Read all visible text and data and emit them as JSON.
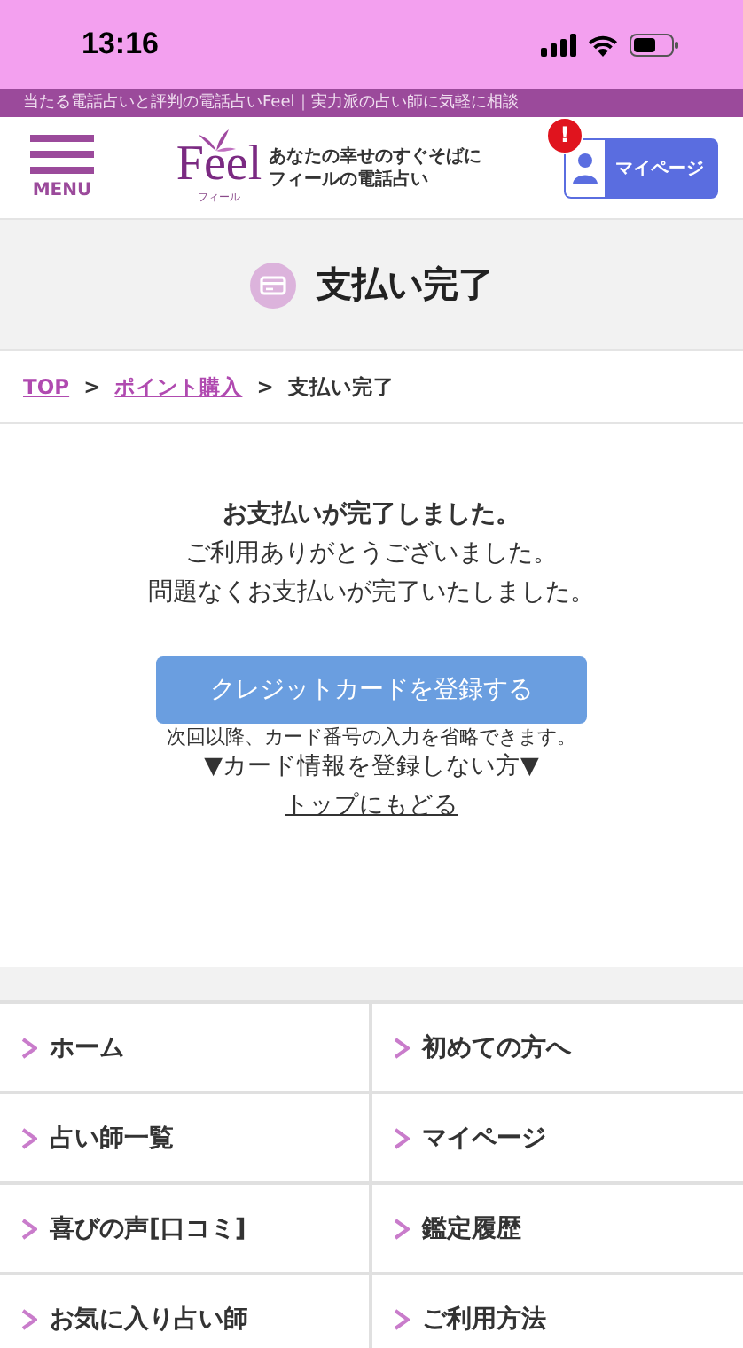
{
  "status_bar": {
    "time": "13:16"
  },
  "tagline": "当たる電話占いと評判の電話占いFeel｜実力派の占い師に気軽に相談",
  "header": {
    "menu_label": "MENU",
    "logo_text": "Feel",
    "logo_sub": "フィール",
    "catch_lines": [
      "あなたの幸せのすぐそばに",
      "フィールの電話占い"
    ],
    "mypage_label": "マイページ",
    "alert_badge": "!"
  },
  "page_title": "支払い完了",
  "breadcrumb": [
    {
      "label": "TOP",
      "kind": "link"
    },
    {
      "label": ">",
      "kind": "sep"
    },
    {
      "label": "ポイント購入",
      "kind": "link"
    },
    {
      "label": ">",
      "kind": "sep"
    },
    {
      "label": "支払い完了",
      "kind": "current"
    }
  ],
  "message": {
    "heading": "お支払いが完了しました。",
    "lines": [
      "ご利用ありがとうございました。",
      "問題なくお支払いが完了いたしました。"
    ]
  },
  "register_button": "クレジットカードを登録する",
  "register_note": "次回以降、カード番号の入力を省略できます。",
  "skip_note": "▼カード情報を登録しない方▼",
  "back_link": "トップにもどる",
  "nav_menu": [
    {
      "label": "ホーム"
    },
    {
      "label": "初めての方へ"
    },
    {
      "label": "占い師一覧"
    },
    {
      "label": "マイページ"
    },
    {
      "label": "喜びの声[口コミ]"
    },
    {
      "label": "鑑定履歴"
    },
    {
      "label": "お気に入り占い師"
    },
    {
      "label": "ご利用方法"
    }
  ]
}
